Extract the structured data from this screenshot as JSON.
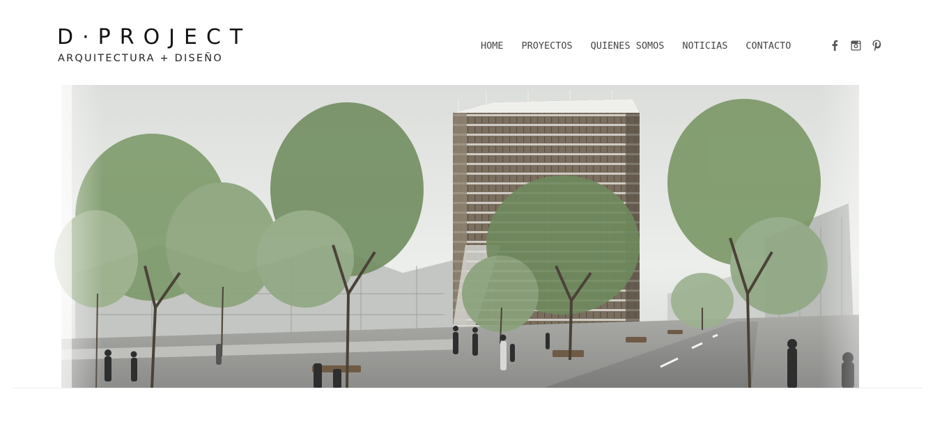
{
  "brand": {
    "logo_main": "D·PROJECT",
    "logo_sub": "ARQUITECTURA + DISEÑO"
  },
  "nav": {
    "items": [
      {
        "label": "HOME"
      },
      {
        "label": "PROYECTOS"
      },
      {
        "label": "QUIENES SOMOS"
      },
      {
        "label": "NOTICIAS"
      },
      {
        "label": "CONTACTO"
      }
    ]
  },
  "social": {
    "icons": [
      "facebook-icon",
      "instagram-icon",
      "pinterest-icon"
    ]
  },
  "hero": {
    "image_subject": "architectural rendering of a green building among trees",
    "colors": {
      "sky": "#e4e6e3",
      "foliage": "#7d9a6a",
      "building": "#6e6456",
      "road": "#8a8a88"
    }
  }
}
